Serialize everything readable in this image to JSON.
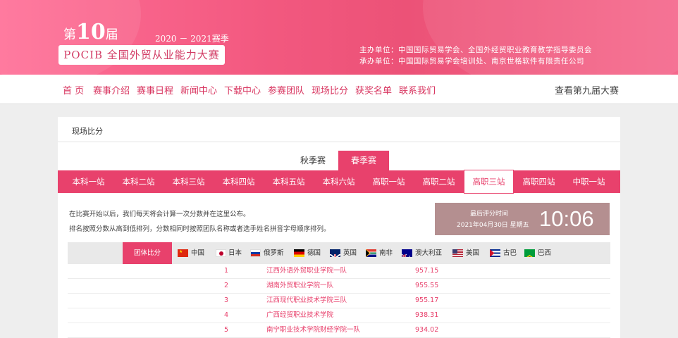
{
  "header": {
    "di": "第",
    "edition": "10",
    "jie": "届",
    "season": "2020 － 2021赛季",
    "competition": "POCIB 全国外贸从业能力大赛",
    "organizer": "主办单位：中国国际贸易学会、全国外经贸职业教育教学指导委员会",
    "co_organizer": "承办单位：中国国际贸易学会培训处、南京世格软件有限责任公司"
  },
  "nav": {
    "items": [
      "首 页",
      "赛事介绍",
      "赛事日程",
      "新闻中心",
      "下载中心",
      "参赛团队",
      "现场比分",
      "获奖名单",
      "联系我们"
    ],
    "right": "查看第九届大赛"
  },
  "card": {
    "title": "现场比分",
    "season_tabs": {
      "autumn": "秋季赛",
      "spring": "春季赛"
    },
    "stations": [
      "本科一站",
      "本科二站",
      "本科三站",
      "本科四站",
      "本科五站",
      "本科六站",
      "高职一站",
      "高职二站",
      "高职三站",
      "高职四站",
      "中职一站"
    ],
    "active_station": "高职三站",
    "info_line1": "在比赛开始以后，我们每天将会计算一次分数并在这里公布。",
    "info_line2": "排名按照分数从高到低排列，分数相同时按照团队名称或者选手姓名拼音字母顺序排列。",
    "time": {
      "label": "最后评分时间",
      "date": "2021年04月30日 星期五",
      "clock": "10:06"
    },
    "filter": {
      "group": "团体比分",
      "countries": [
        "中国",
        "日本",
        "俄罗斯",
        "德国",
        "英国",
        "南非",
        "澳大利亚",
        "美国",
        "古巴",
        "巴西"
      ]
    },
    "rows": [
      {
        "rank": "1",
        "team": "江西外语外贸职业学院一队",
        "score": "957.15"
      },
      {
        "rank": "2",
        "team": "湖南外贸职业学院一队",
        "score": "955.55"
      },
      {
        "rank": "3",
        "team": "江西现代职业技术学院三队",
        "score": "955.17"
      },
      {
        "rank": "4",
        "team": "广西经贸职业技术学院",
        "score": "938.31"
      },
      {
        "rank": "5",
        "team": "南宁职业技术学院财经学院一队",
        "score": "934.02"
      }
    ]
  },
  "colors": {
    "accent": "#e8416c",
    "time_box": "#b48f90"
  }
}
